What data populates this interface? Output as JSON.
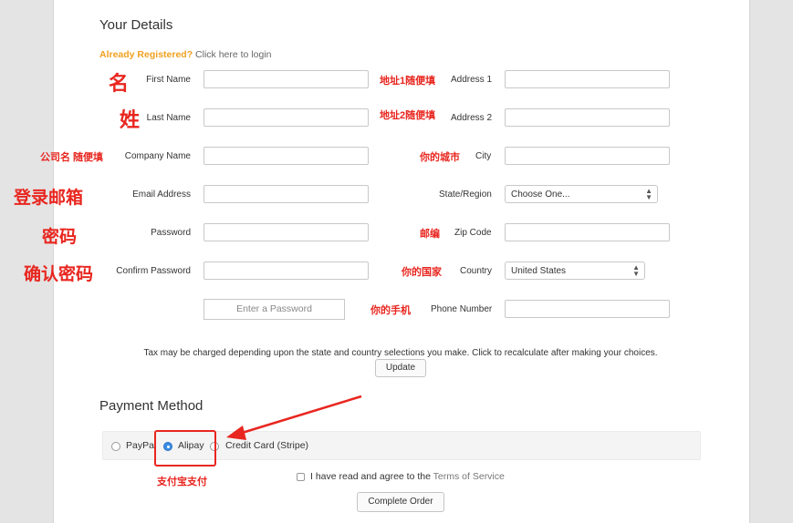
{
  "details": {
    "heading": "Your Details",
    "already_registered": "Already Registered?",
    "login_link": "Click here to login"
  },
  "fields_left": [
    {
      "label": "First Name",
      "annotation": "名"
    },
    {
      "label": "Last Name",
      "annotation": "姓"
    },
    {
      "label": "Company Name",
      "annotation": "公司名 随便填"
    },
    {
      "label": "Email Address",
      "annotation": "登录邮箱"
    },
    {
      "label": "Password",
      "annotation": "密码"
    },
    {
      "label": "Confirm Password",
      "annotation": "确认密码"
    }
  ],
  "password_strength_placeholder": "Enter a Password",
  "fields_right": [
    {
      "label": "Address 1",
      "annotation": "地址1随便填"
    },
    {
      "label": "Address 2",
      "annotation": "地址2随便填"
    },
    {
      "label": "City",
      "annotation": "你的城市"
    },
    {
      "label": "State/Region",
      "value": "Choose One..."
    },
    {
      "label": "Zip Code",
      "annotation": "邮编"
    },
    {
      "label": "Country",
      "annotation": "你的国家",
      "value": "United States"
    },
    {
      "label": "Phone Number",
      "annotation": "你的手机"
    }
  ],
  "tax_note": "Tax may be charged depending upon the state and country selections you make. Click to recalculate after making your choices.",
  "update_label": "Update",
  "payment": {
    "heading": "Payment Method",
    "options": [
      {
        "label": "PayPal",
        "selected": false
      },
      {
        "label": "Alipay",
        "selected": true
      },
      {
        "label": "Credit Card (Stripe)",
        "selected": false
      }
    ],
    "annotation": "支付宝支付"
  },
  "tos": {
    "text": "I have read and agree to the",
    "link": "Terms of Service"
  },
  "complete_label": "Complete Order",
  "colors": {
    "annotation": "#e8261f",
    "highlight": "#f0a020",
    "radio_selected": "#3a8ee6"
  }
}
